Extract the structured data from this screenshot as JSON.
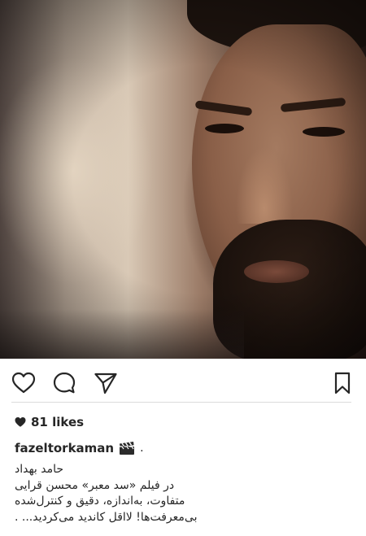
{
  "post": {
    "likes_text": "81 likes",
    "username": "fazeltorkaman",
    "username_suffix": ".",
    "caption_lines": [
      "حامد بهداد",
      "در فیلم «سد معبر» محسن قرایی",
      "متفاوت، به‌اندازه، دقیق و کنترل‌شده",
      "بی‌معرفت‌ها! لااقل کاندید می‌کردید... ."
    ]
  },
  "icons": {
    "like": "heart-outline-icon",
    "comment": "comment-bubble-icon",
    "share": "paper-plane-icon",
    "save": "bookmark-icon",
    "likes": "heart-filled-icon",
    "caption": "clapperboard-emoji"
  },
  "colors": {
    "text": "#262626",
    "divider": "#dbdbdb",
    "background": "#ffffff"
  }
}
